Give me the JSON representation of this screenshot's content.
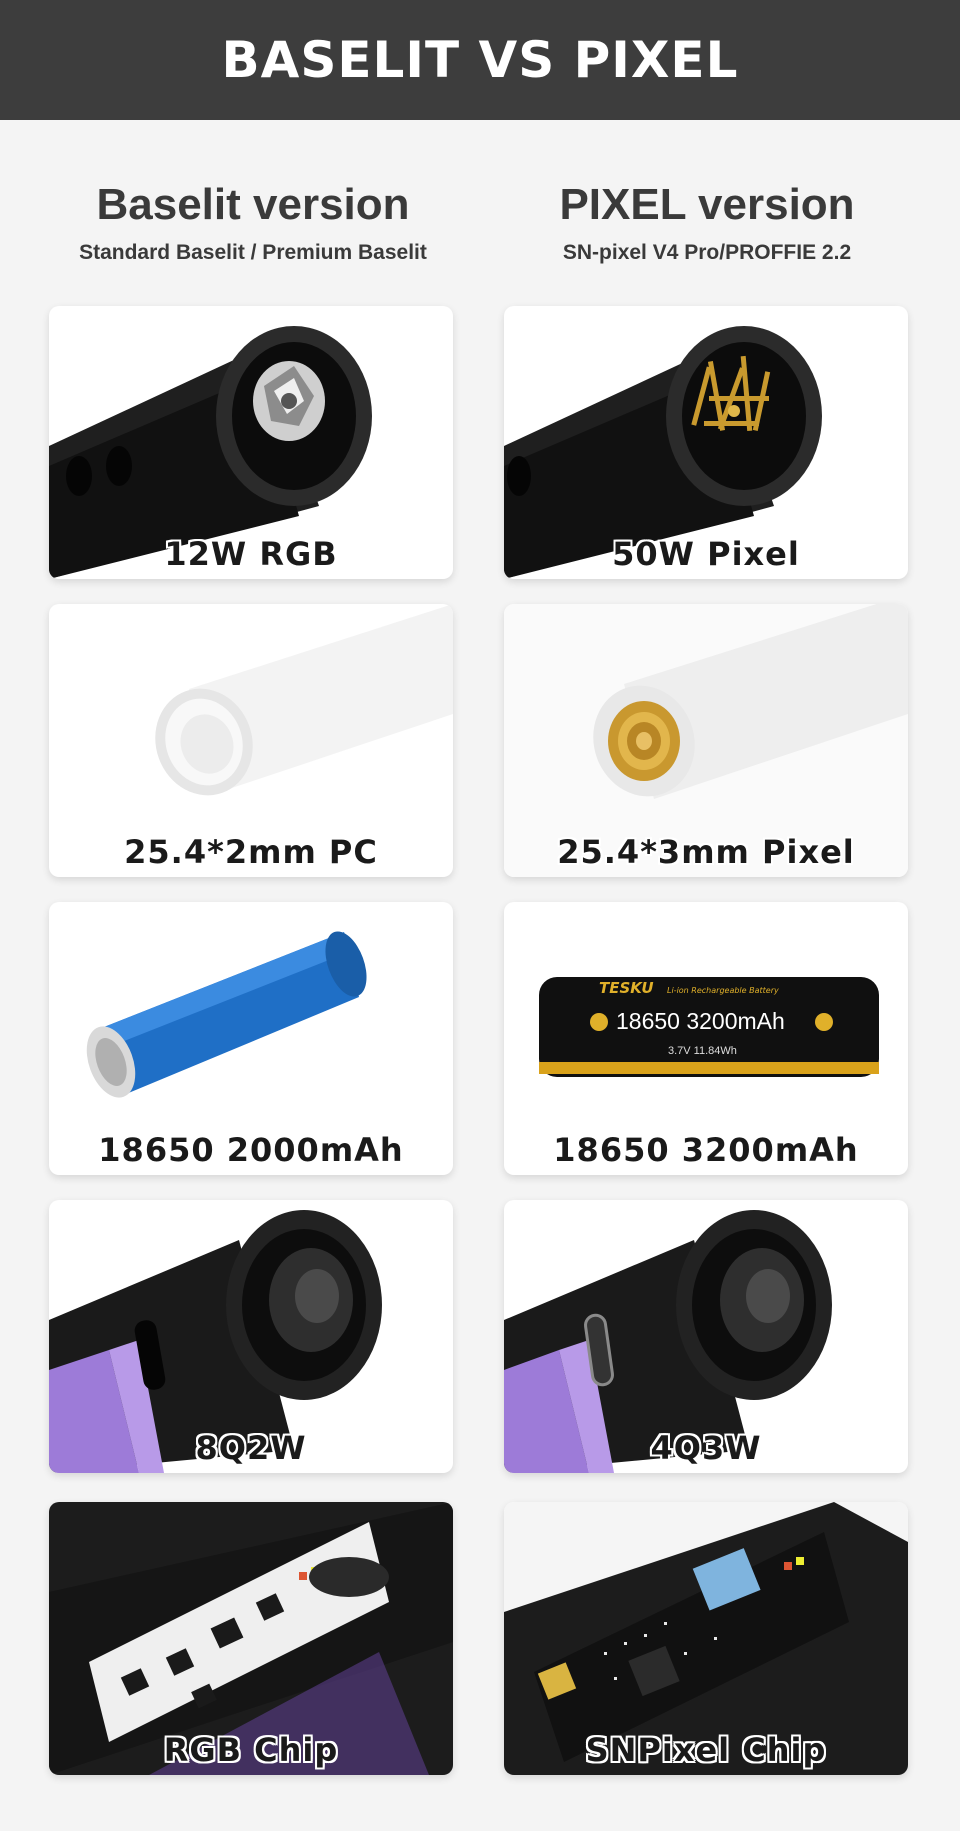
{
  "header": {
    "title": "BASELIT VS PIXEL"
  },
  "columns": [
    {
      "title": "Baselit version",
      "subtitle": "Standard Baselit / Premium Baselit"
    },
    {
      "title": "PIXEL version",
      "subtitle": "SN-pixel V4 Pro/PROFFIE 2.2"
    }
  ],
  "rows": [
    {
      "left": {
        "label": "12W RGB",
        "image": "rgb-led-emitter"
      },
      "right": {
        "label": "50W Pixel",
        "image": "pixel-connector-pins"
      }
    },
    {
      "left": {
        "label": "25.4*2mm PC",
        "image": "pc-blade-tube"
      },
      "right": {
        "label": "25.4*3mm Pixel",
        "image": "pixel-blade-tube"
      }
    },
    {
      "left": {
        "label": "18650 2000mAh",
        "image": "blue-battery"
      },
      "right": {
        "label": "18650 3200mAh",
        "image": "tesku-battery",
        "battery_brand": "TESKU",
        "battery_tag": "Li-ion Rechargeable Battery",
        "battery_model": "18650 3200mAh",
        "battery_spec": "3.7V 11.84Wh"
      }
    },
    {
      "left": {
        "label": "8Q2W",
        "image": "speaker-module"
      },
      "right": {
        "label": "4Q3W",
        "image": "speaker-module-usbc"
      }
    },
    {
      "left": {
        "label": "RGB Chip",
        "image": "rgb-circuit-board"
      },
      "right": {
        "label": "SNPixel Chip",
        "image": "snpixel-circuit-board"
      }
    }
  ]
}
